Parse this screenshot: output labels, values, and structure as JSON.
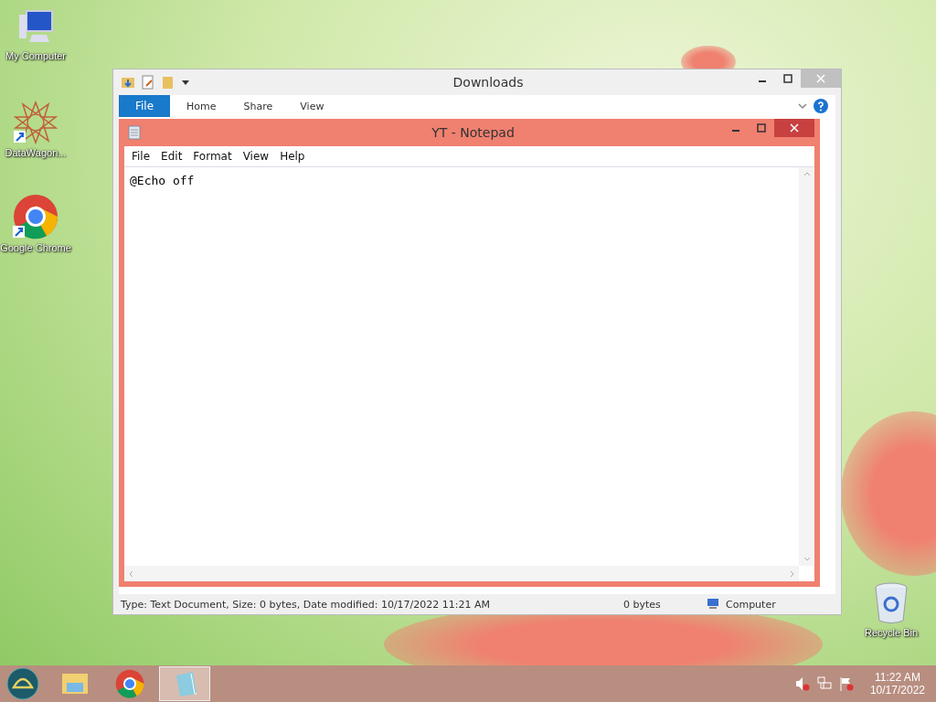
{
  "desktop_icons": [
    {
      "kind": "computer",
      "label": "My Computer",
      "shortcut": false
    },
    {
      "kind": "app",
      "label": "DataWagon...",
      "shortcut": true
    },
    {
      "kind": "browser",
      "label": "Google Chrome",
      "shortcut": true
    },
    {
      "kind": "recycle-bin",
      "label": "Recycle Bin",
      "shortcut": false
    }
  ],
  "explorer": {
    "title": "Downloads",
    "ribbon_tabs": [
      {
        "kind": "file-menu",
        "label": "File"
      },
      {
        "kind": "tab",
        "label": "Home"
      },
      {
        "kind": "tab",
        "label": "Share"
      },
      {
        "kind": "tab",
        "label": "View"
      }
    ],
    "status_bar": [
      "Type: Text Document, Size: 0 bytes, Date modified: 10/17/2022 11:21 AM",
      "0 bytes",
      "Computer"
    ]
  },
  "notepad": {
    "title": "YT - Notepad",
    "active": true,
    "menu": [
      "File",
      "Edit",
      "Format",
      "View",
      "Help"
    ],
    "content": "@Echo off"
  },
  "taskbar": {
    "items": [
      {
        "kind": "start",
        "selected": false
      },
      {
        "kind": "explorer",
        "selected": false
      },
      {
        "kind": "browser",
        "selected": false
      },
      {
        "kind": "notepad",
        "selected": true
      }
    ],
    "tray_icons": [
      {
        "kind": "volume"
      },
      {
        "kind": "network"
      },
      {
        "kind": "flag"
      }
    ],
    "time": "11:22 AM",
    "date": "10/17/2022"
  }
}
